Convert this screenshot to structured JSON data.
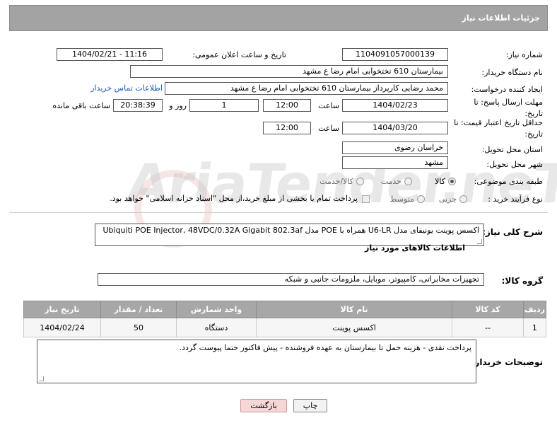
{
  "header": {
    "title": "جزئیات اطلاعات نیاز"
  },
  "fields": {
    "need_number_label": "شماره نیاز:",
    "need_number": "1104091057000139",
    "announce_label": "تاریخ و ساعت اعلان عمومی:",
    "announce_value": "1404/02/21 - 11:16",
    "buyer_org_label": "نام دستگاه خریدار:",
    "buyer_org": "بیمارستان 610 تختخوابی امام رضا ع  مشهد",
    "creator_label": "ایجاد کننده درخواست:",
    "creator": "محمد رضایی کارپرداز بیمارستان 610 تختخوابی امام رضا ع  مشهد",
    "contact_link": "اطلاعات تماس خریدار",
    "reply_deadline_label": "مهلت ارسال پاسخ: تا تاریخ:",
    "reply_date": "1404/02/23",
    "time_label": "ساعت",
    "reply_time": "12:00",
    "days_value": "1",
    "days_label": "روز و",
    "remaining_value": "20:38:39",
    "remaining_label": "ساعت باقی مانده",
    "price_deadline_label": "حداقل تاریخ اعتبار قیمت: تا تاریخ:",
    "price_date": "1404/03/20",
    "price_time": "12:00",
    "province_label": "استان محل تحویل:",
    "province": "خراسان رضوی",
    "city_label": "شهر محل تحویل:",
    "city": "مشهد",
    "category_label": "طبقه بندی موضوعی:",
    "category_options": [
      "کالا",
      "خدمت",
      "کالا/خدمت"
    ],
    "process_label": "نوع فرآیند خرید :",
    "process_options": [
      "جزیی",
      "متوسط"
    ],
    "payment_note": "پرداخت تمام یا بخشی از مبلغ خرید،از محل \"اسناد خزانه اسلامی\" خواهد بود."
  },
  "description": {
    "label": "شرح کلی نیاز:",
    "value": "اکسس پوینت یونیفای مدل U6-LR همراه با POE مدل Ubiquiti POE Injector, 48VDC/0.32A Gigabit 802.3af"
  },
  "goods_section": {
    "title": "اطلاعات کالاهای مورد نیاز",
    "group_label": "گروه کالا:",
    "group_value": "تجهیزات مخابراتی، کامپیوتر، موبایل، ملزومات جانبی و شبکه"
  },
  "table": {
    "headers": [
      "ردیف",
      "کد کالا",
      "نام کالا",
      "واحد شمارش",
      "تعداد / مقدار",
      "تاریخ نیاز"
    ],
    "rows": [
      [
        "1",
        "--",
        "اکسس پوینت",
        "دستگاه",
        "50",
        "1404/02/24"
      ]
    ]
  },
  "buyer_notes": {
    "label": "توضیحات خریدار:",
    "value": "پرداخت نقدی - هزینه حمل تا بیمارستان به عهده فروشنده - پیش فاکتور حتما پیوست گردد."
  },
  "buttons": {
    "print": "چاپ",
    "back": "بازگشت"
  },
  "watermark": "AriaTender.neT",
  "colors": {
    "header_bg": "#a3a3a3",
    "link": "#1a56c0",
    "back_button_bg": "#f7d6d6"
  }
}
